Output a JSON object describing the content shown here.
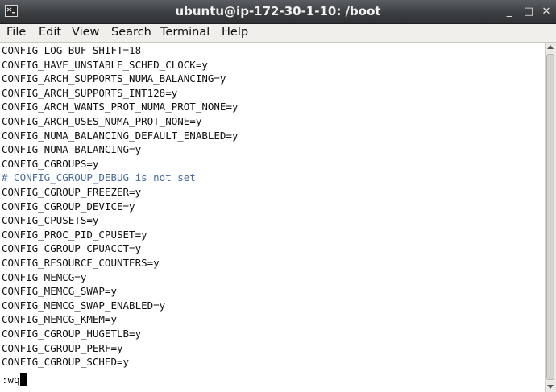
{
  "window": {
    "title": "ubuntu@ip-172-30-1-10: /boot",
    "controls": {
      "minimize": "_",
      "maximize": "□",
      "close": "✕"
    }
  },
  "menubar": {
    "items": [
      "File",
      "Edit",
      "View",
      "Search",
      "Terminal",
      "Help"
    ]
  },
  "terminal": {
    "lines": [
      "CONFIG_LOG_BUF_SHIFT=18",
      "CONFIG_HAVE_UNSTABLE_SCHED_CLOCK=y",
      "CONFIG_ARCH_SUPPORTS_NUMA_BALANCING=y",
      "CONFIG_ARCH_SUPPORTS_INT128=y",
      "CONFIG_ARCH_WANTS_PROT_NUMA_PROT_NONE=y",
      "CONFIG_ARCH_USES_NUMA_PROT_NONE=y",
      "CONFIG_NUMA_BALANCING_DEFAULT_ENABLED=y",
      "CONFIG_NUMA_BALANCING=y",
      "CONFIG_CGROUPS=y",
      "# CONFIG_CGROUP_DEBUG is not set",
      "CONFIG_CGROUP_FREEZER=y",
      "CONFIG_CGROUP_DEVICE=y",
      "CONFIG_CPUSETS=y",
      "CONFIG_PROC_PID_CPUSET=y",
      "CONFIG_CGROUP_CPUACCT=y",
      "CONFIG_RESOURCE_COUNTERS=y",
      "CONFIG_MEMCG=y",
      "CONFIG_MEMCG_SWAP=y",
      "CONFIG_MEMCG_SWAP_ENABLED=y",
      "CONFIG_MEMCG_KMEM=y",
      "CONFIG_CGROUP_HUGETLB=y",
      "CONFIG_CGROUP_PERF=y",
      "CONFIG_CGROUP_SCHED=y"
    ],
    "command_line": ":wq"
  },
  "colors": {
    "comment": "#4b6a9b",
    "text": "#111111",
    "background": "#ffffff"
  }
}
